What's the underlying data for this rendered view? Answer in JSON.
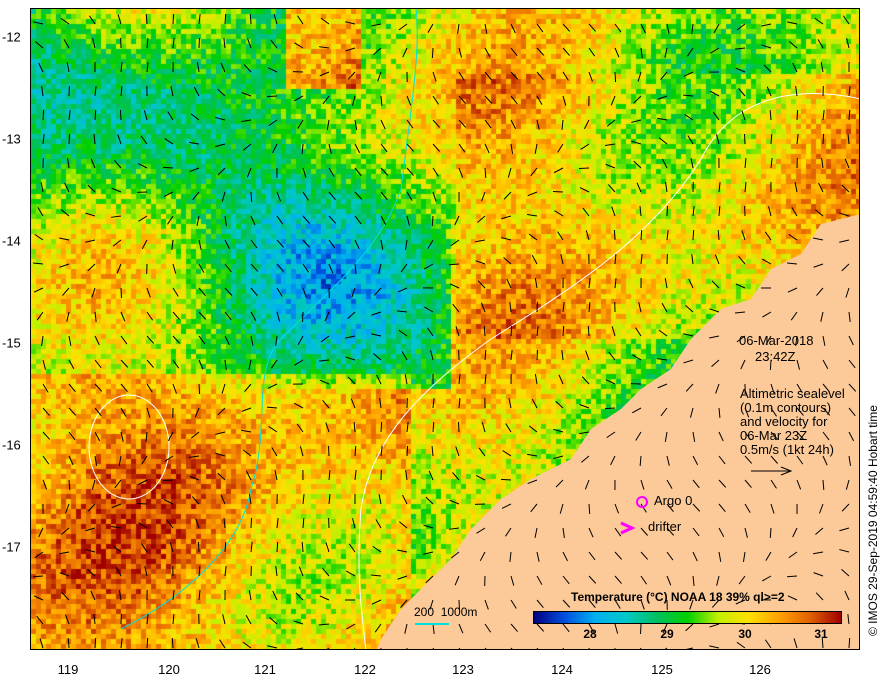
{
  "x_axis": {
    "ticks": [
      "119",
      "120",
      "121",
      "122",
      "123",
      "124",
      "125",
      "126"
    ]
  },
  "y_axis": {
    "ticks": [
      "-12",
      "-13",
      "-14",
      "-15",
      "-16",
      "-17"
    ]
  },
  "timestamp": {
    "date": "06-Mar-2018",
    "time": "23:42Z"
  },
  "legend_text": [
    "Altimetric sealevel",
    "(0.1m contours)",
    "and velocity for",
    "06-Mar 23Z",
    "0.5m/s (1kt 24h)"
  ],
  "markers": {
    "argo": "Argo 0",
    "drifter": "drifter"
  },
  "bathymetry_label": "200  1000m",
  "colorbar": {
    "title": "Temperature (°C) NOAA 18 39% ql>=2",
    "labels": [
      "28",
      "29",
      "30",
      "31"
    ],
    "range": [
      27.3,
      31.2
    ]
  },
  "credit": "© IMOS 29-Sep-2019 04:59:40 Hobart time",
  "colors": {
    "land": "#fcc998",
    "contour": "#ffffff",
    "bathy": "#00e0e0",
    "marker": "#ff00ff"
  }
}
